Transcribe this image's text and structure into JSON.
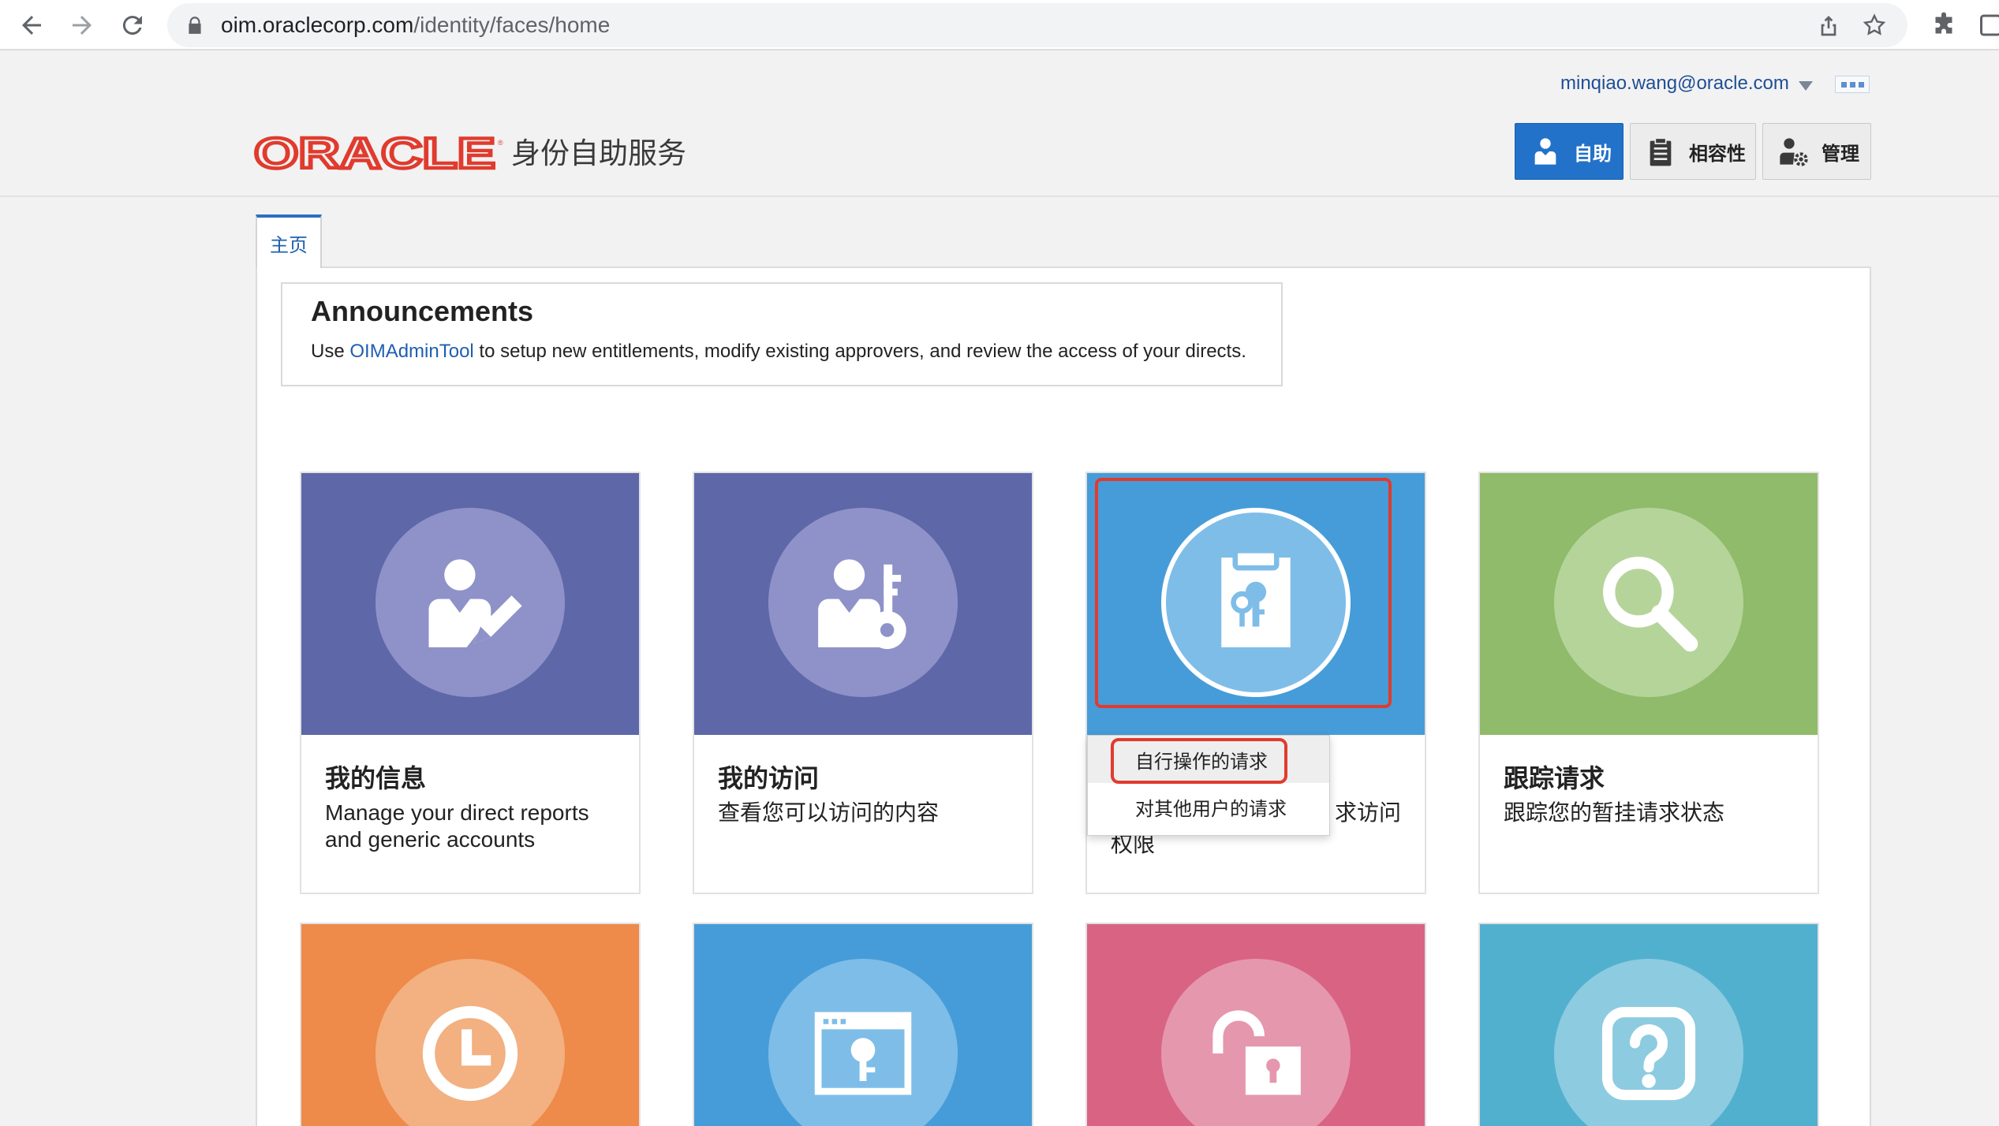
{
  "browser": {
    "url_host": "oim.oraclecorp.com",
    "url_path": "/identity/faces/home"
  },
  "header": {
    "user_email": "minqiao.wang@oracle.com",
    "logo_text": "ORACLE",
    "product_title": "身份自助服务",
    "roles": [
      {
        "label": "自助",
        "icon": "user-icon",
        "active": true
      },
      {
        "label": "相容性",
        "icon": "clipboard-icon",
        "active": false
      },
      {
        "label": "管理",
        "icon": "user-gear-icon",
        "active": false
      }
    ]
  },
  "tabs": [
    {
      "label": "主页",
      "active": true
    }
  ],
  "announcements": {
    "title": "Announcements",
    "text_before": "Use",
    "link": "OIMAdminTool",
    "text_after": "to setup new entitlements, modify existing approvers, and review the access of your directs."
  },
  "tiles": [
    {
      "title": "我的信息",
      "description": "Manage your direct reports and generic accounts",
      "icon": "user-edit-icon",
      "color": "#5e67a8"
    },
    {
      "title": "我的访问",
      "description": "查看您可以访问的内容",
      "icon": "user-key-icon",
      "color": "#5e67a8"
    },
    {
      "title": "",
      "description_tail_line1": "求访问",
      "description_tail_line2": "权限",
      "icon": "request-access-icon",
      "color": "#469cd8"
    },
    {
      "title": "跟踪请求",
      "description": "跟踪您的暂挂请求状态",
      "icon": "search-icon",
      "color": "#8fbb6a"
    },
    {
      "icon": "clock-icon",
      "color": "#ee8a4a"
    },
    {
      "icon": "browser-key-icon",
      "color": "#469cd8"
    },
    {
      "icon": "unlock-icon",
      "color": "#d96383"
    },
    {
      "icon": "help-icon",
      "color": "#52b0cf"
    }
  ],
  "request_menu": {
    "items": [
      {
        "label": "自行操作的请求",
        "selected": true
      },
      {
        "label": "对其他用户的请求",
        "selected": false
      }
    ]
  },
  "colors": {
    "accent_blue": "#2272c9",
    "oracle_red": "#e03b2e",
    "link": "#1f5fb0"
  }
}
